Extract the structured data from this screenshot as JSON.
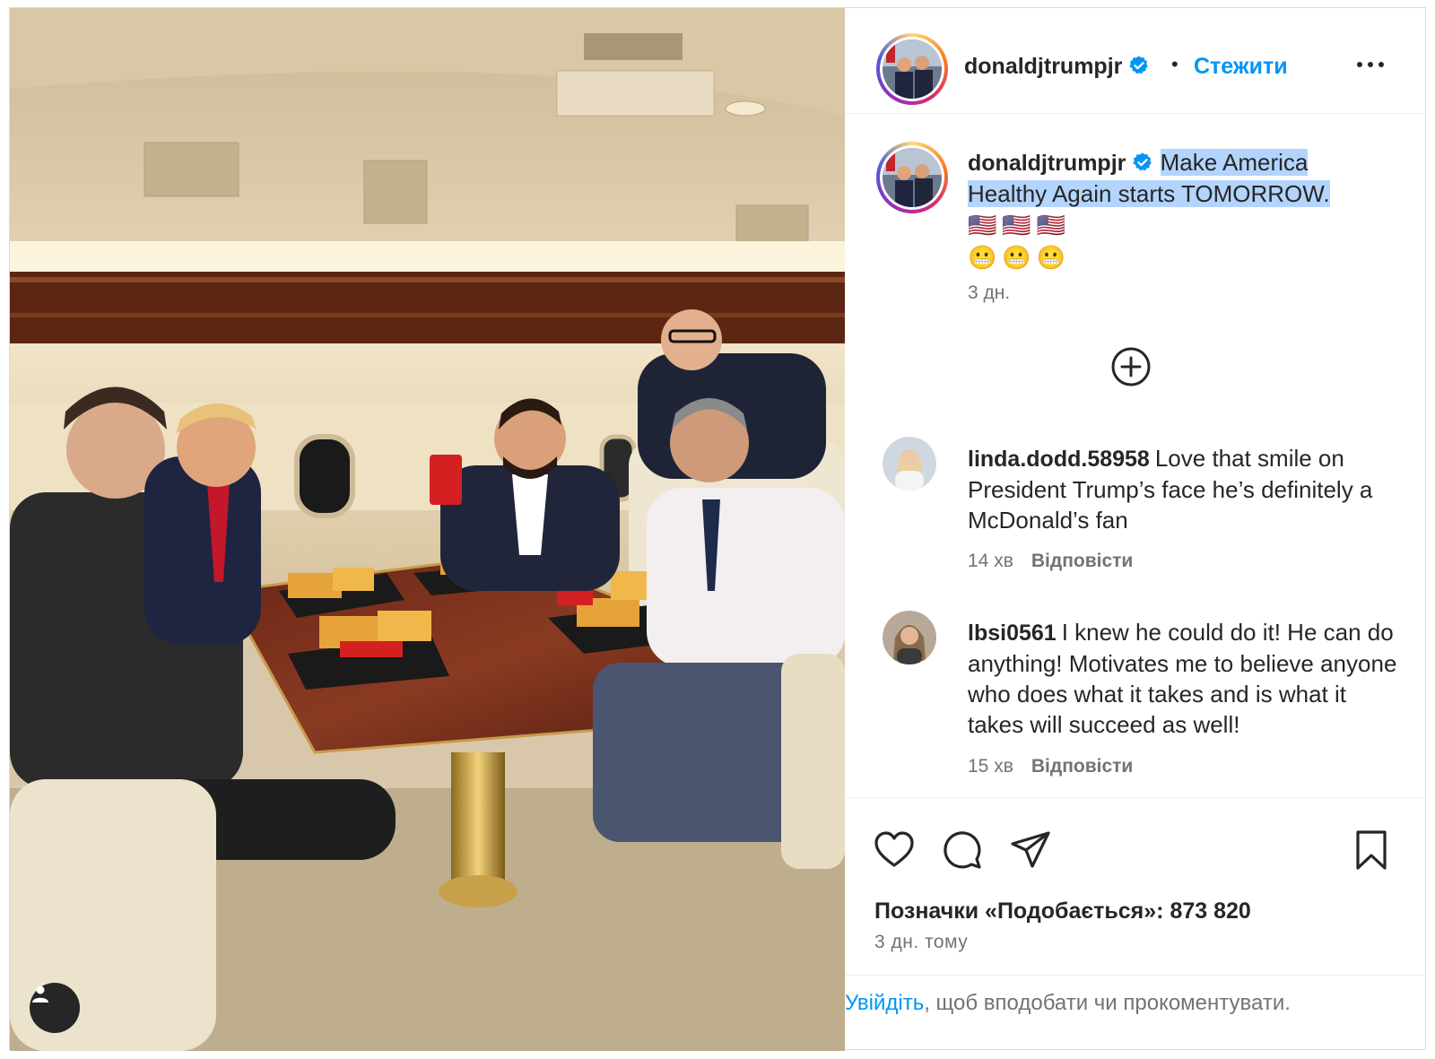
{
  "post": {
    "username": "donaldjtrumpjr",
    "follow_label": "Стежити",
    "separator": "•",
    "caption": {
      "username": "donaldjtrumpjr",
      "text_line1": "Make America",
      "text_line2": "Healthy Again starts TOMORROW.",
      "flags": "🇺🇸🇺🇸🇺🇸",
      "emojis": "😬😬😬",
      "time": "3 дн."
    },
    "comments": [
      {
        "username": "linda.dodd.58958",
        "text": "Love that smile on President Trump’s face he’s definitely a McDonald’s fan",
        "time": "14 хв",
        "reply_label": "Відповісти"
      },
      {
        "username": "lbsi0561",
        "text": "I knew he could do it! He can do anything! Motivates me to believe anyone who does what it takes and is what it takes will succeed as well!",
        "time": "15 хв",
        "reply_label": "Відповісти"
      }
    ],
    "likes": "Позначки «Подобається»: 873 820",
    "posted_time": "3 дн. тому",
    "footer": {
      "login_link": "Увійдіть",
      "rest": ", щоб вподобати чи прокоментувати."
    }
  },
  "icons": {
    "verified": "verified-badge-icon",
    "more": "more-options-icon",
    "load_more": "plus-circle-icon",
    "like": "heart-icon",
    "comment": "comment-bubble-icon",
    "share": "paper-plane-icon",
    "save": "bookmark-icon",
    "tag": "user-tag-icon"
  },
  "colors": {
    "accent": "#0095f6",
    "text": "#262626",
    "secondary": "#737373",
    "highlight": "#b3d4fc"
  }
}
